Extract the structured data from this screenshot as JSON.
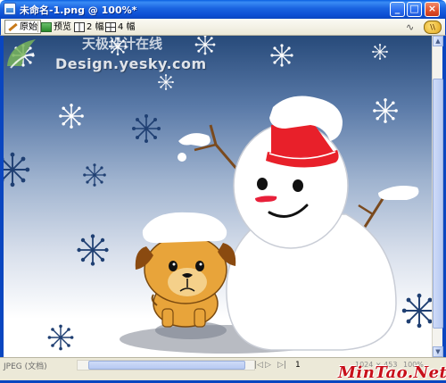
{
  "window": {
    "title": "未命名-1.png @ 100%*",
    "minimize_glyph": "_",
    "maximize_glyph": "□",
    "close_glyph": "×"
  },
  "toolbar": {
    "original_label": "原始",
    "preview_label": "预览",
    "two_up_label": "2 幅",
    "four_up_label": "4 幅",
    "right_icon_label": "∿",
    "right_icon2_label": "\\\\"
  },
  "canvas": {
    "watermark_cn": "天极设计在线",
    "watermark_en": "Design.yesky.com"
  },
  "statusbar": {
    "file_type": "JPEG (文档)",
    "page": "1",
    "dimensions": "1024 × 453",
    "zoom": "100%",
    "brand": "MinTao.Net"
  },
  "colors": {
    "title_bar": "#0a5fe0",
    "sky_top": "#274a7a",
    "sky_bottom": "#ffffff",
    "hat_red": "#e8202a",
    "dog_body": "#e8a43a",
    "brand_red": "#c8101a"
  }
}
